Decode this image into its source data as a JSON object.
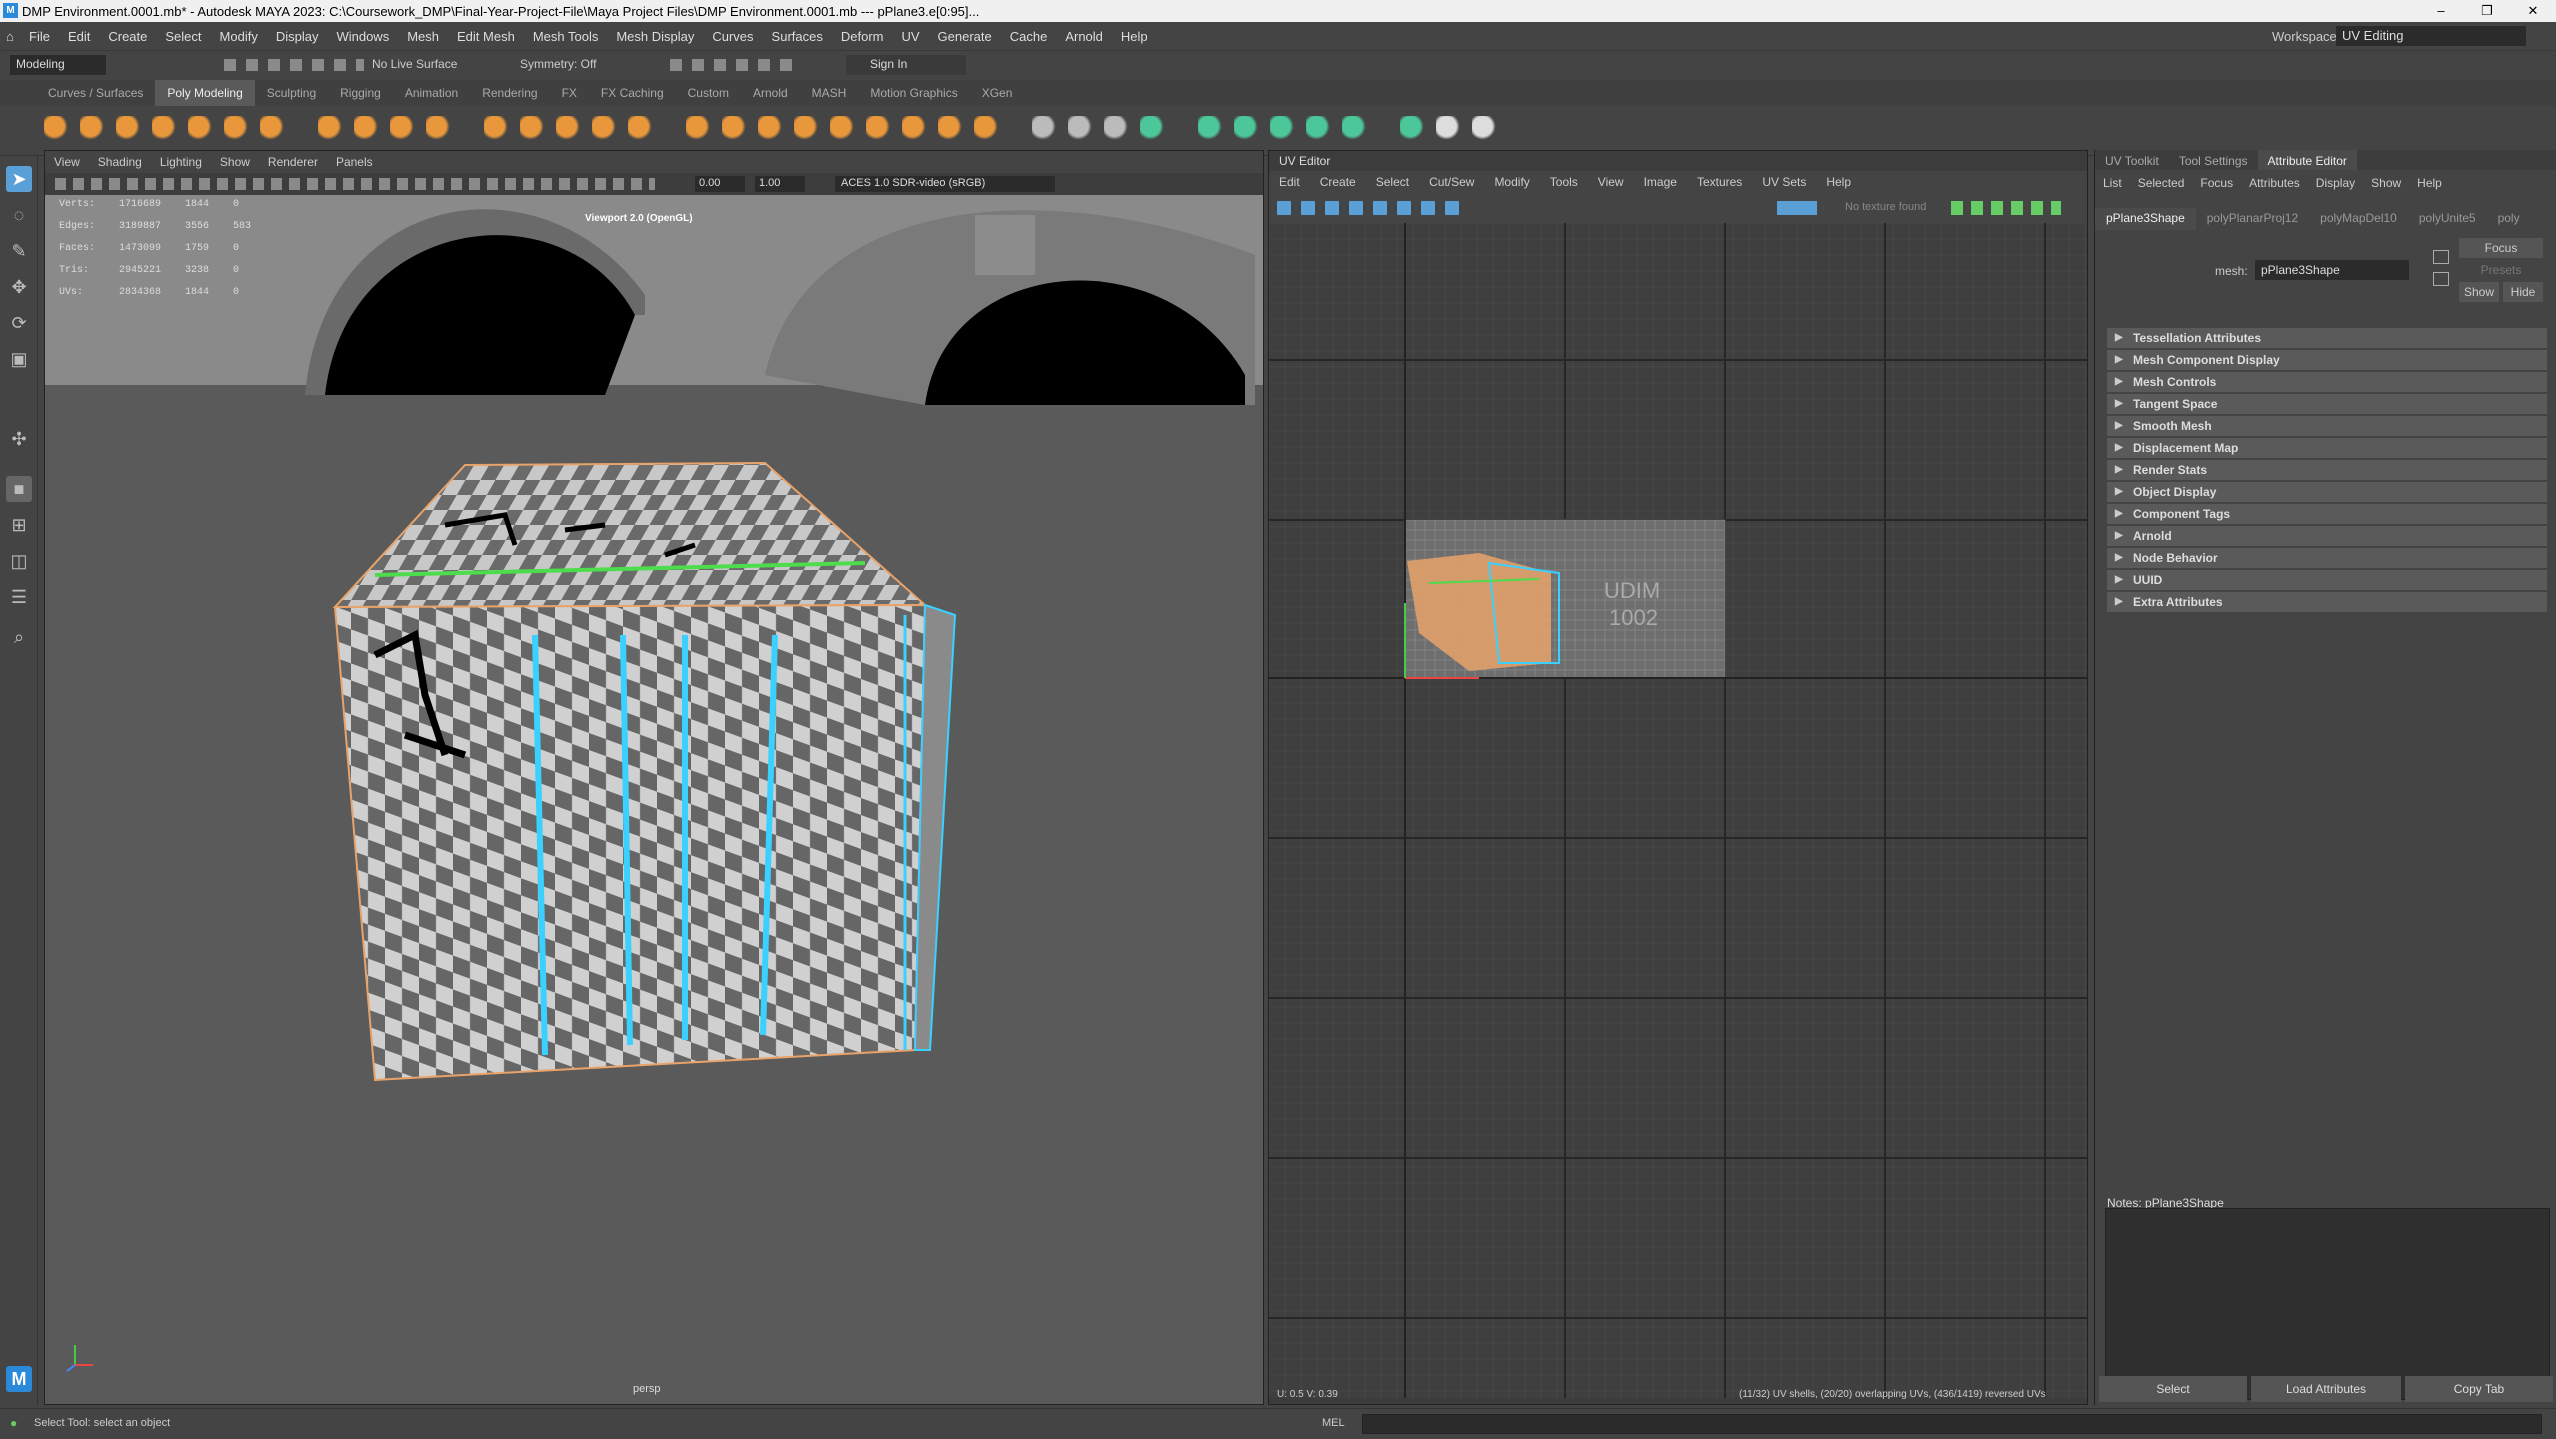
{
  "window": {
    "title": "DMP Environment.0001.mb* - Autodesk MAYA 2023: C:\\Coursework_DMP\\Final-Year-Project-File\\Maya Project Files\\DMP Environment.0001.mb  ---  pPlane3.e[0:95]...",
    "minimize_label": "–",
    "maximize_label": "❐",
    "close_label": "✕"
  },
  "menubar": {
    "items": [
      "File",
      "Edit",
      "Create",
      "Select",
      "Modify",
      "Display",
      "Windows",
      "Mesh",
      "Edit Mesh",
      "Mesh Tools",
      "Mesh Display",
      "Curves",
      "Surfaces",
      "Deform",
      "UV",
      "Generate",
      "Cache",
      "Arnold",
      "Help"
    ],
    "workspace_label": "Workspace:",
    "workspace_value": "UV Editing"
  },
  "statusline": {
    "mode": "Modeling",
    "live_surface": "No Live Surface",
    "symmetry": "Symmetry: Off",
    "sign_in": "Sign In"
  },
  "shelf_tabs": [
    "Curves / Surfaces",
    "Poly Modeling",
    "Sculpting",
    "Rigging",
    "Animation",
    "Rendering",
    "FX",
    "FX Caching",
    "Custom",
    "Arnold",
    "MASH",
    "Motion Graphics",
    "XGen"
  ],
  "shelf_active": "Poly Modeling",
  "viewport": {
    "menu": [
      "View",
      "Shading",
      "Lighting",
      "Show",
      "Renderer",
      "Panels"
    ],
    "renderer_label": "Viewport 2.0 (OpenGL)",
    "camera": "persp",
    "exposure": "0.00",
    "gamma": "1.00",
    "colorspace": "ACES 1.0 SDR-video (sRGB)",
    "hud": [
      {
        "label": "Verts:",
        "a": "1716689",
        "b": "1844",
        "c": "0"
      },
      {
        "label": "Edges:",
        "a": "3189887",
        "b": "3556",
        "c": "583"
      },
      {
        "label": "Faces:",
        "a": "1473099",
        "b": "1759",
        "c": "0"
      },
      {
        "label": "Tris:",
        "a": "2945221",
        "b": "3238",
        "c": "0"
      },
      {
        "label": "UVs:",
        "a": "2834368",
        "b": "1844",
        "c": "0"
      }
    ]
  },
  "uv_editor": {
    "title": "UV Editor",
    "menu": [
      "Edit",
      "Create",
      "Select",
      "Cut/Sew",
      "Modify",
      "Tools",
      "View",
      "Image",
      "Textures",
      "UV Sets",
      "Help"
    ],
    "texture_status": "No texture found",
    "udim_label": "UDIM\n1002",
    "coords": "U: 0.5  V: 0.39",
    "stats": "(11/32) UV shells, (20/20) overlapping UVs, (436/1419) reversed UVs"
  },
  "attribute_editor": {
    "tabs": [
      "UV Toolkit",
      "Tool Settings",
      "Attribute Editor"
    ],
    "active_tab": "Attribute Editor",
    "menu": [
      "List",
      "Selected",
      "Focus",
      "Attributes",
      "Display",
      "Show",
      "Help"
    ],
    "node_tabs": [
      "pPlane3Shape",
      "polyPlanarProj12",
      "polyMapDel10",
      "polyUnite5",
      "poly"
    ],
    "mesh_label": "mesh:",
    "mesh_value": "pPlane3Shape",
    "focus_btn": "Focus",
    "presets_btn": "Presets",
    "show_btn": "Show",
    "hide_btn": "Hide",
    "sections": [
      "Tessellation Attributes",
      "Mesh Component Display",
      "Mesh Controls",
      "Tangent Space",
      "Smooth Mesh",
      "Displacement Map",
      "Render Stats",
      "Object Display",
      "Component Tags",
      "Arnold",
      "Node Behavior",
      "UUID",
      "Extra Attributes"
    ],
    "notes_label": "Notes:  pPlane3Shape",
    "select_btn": "Select",
    "load_btn": "Load Attributes",
    "copy_btn": "Copy Tab"
  },
  "status": {
    "help": "Select Tool: select an object",
    "mel_label": "MEL"
  },
  "colors": {
    "accent": "#5a9fd6",
    "uv_orange": "#e8a36a",
    "uv_cyan": "#3ad0ff"
  }
}
